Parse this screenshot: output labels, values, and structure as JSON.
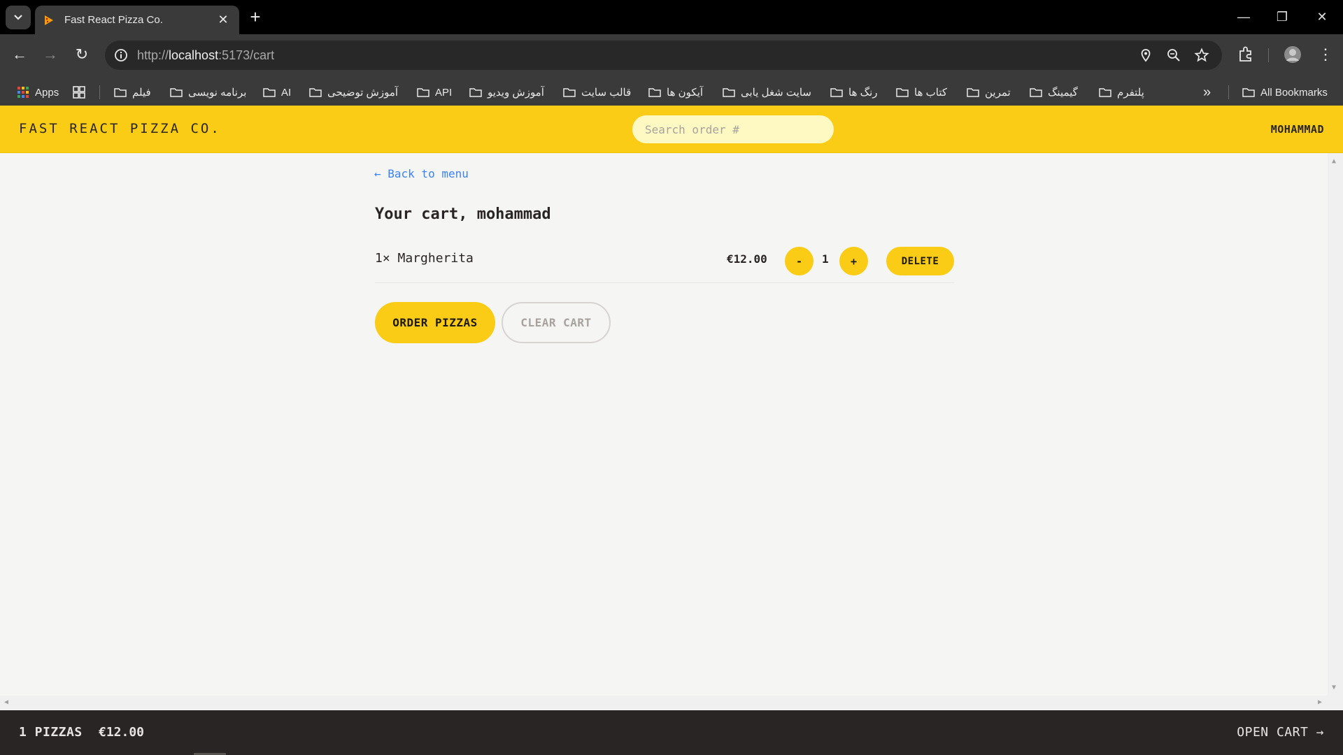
{
  "browser": {
    "tab_title": "Fast React Pizza Co.",
    "tab_close": "✕",
    "new_tab": "+",
    "url_host": "localhost",
    "url_prefix": "http://",
    "url_suffix": ":5173/cart",
    "window_controls": {
      "minimize": "—",
      "restore": "❐",
      "close": "✕"
    },
    "nav": {
      "back": "←",
      "forward": "→",
      "reload": "↻"
    },
    "bookmarks": {
      "apps": "Apps",
      "items": [
        "فیلم",
        "برنامه نویسی",
        "AI",
        "آموزش توضیحی",
        "API",
        "آموزش ویدیو",
        "قالب سایت",
        "آیکون ها",
        "سایت شغل یابی",
        "رنگ ها",
        "کتاب ها",
        "تمرین",
        "گیمینگ",
        "پلتفرم"
      ],
      "overflow": "»",
      "all_bookmarks": "All Bookmarks"
    }
  },
  "header": {
    "logo": "FAST REACT PIZZA CO.",
    "search_placeholder": "Search order #",
    "username": "MOHAMMAD"
  },
  "cart": {
    "back_link": "← Back to menu",
    "title": "Your cart, mohammad",
    "items": [
      {
        "name": "1× Margherita",
        "price": "€12.00",
        "quantity": "1",
        "decrease": "-",
        "increase": "+",
        "delete": "DELETE"
      }
    ],
    "order_button": "ORDER PIZZAS",
    "clear_button": "CLEAR CART"
  },
  "footer": {
    "count": "1 PIZZAS",
    "total": "€12.00",
    "open_cart": "OPEN CART →"
  },
  "colors": {
    "accent": "#facc15",
    "header_bg": "#facc15",
    "footer_bg": "#292524",
    "link": "#3b82f6",
    "page_bg": "#f5f5f4"
  }
}
